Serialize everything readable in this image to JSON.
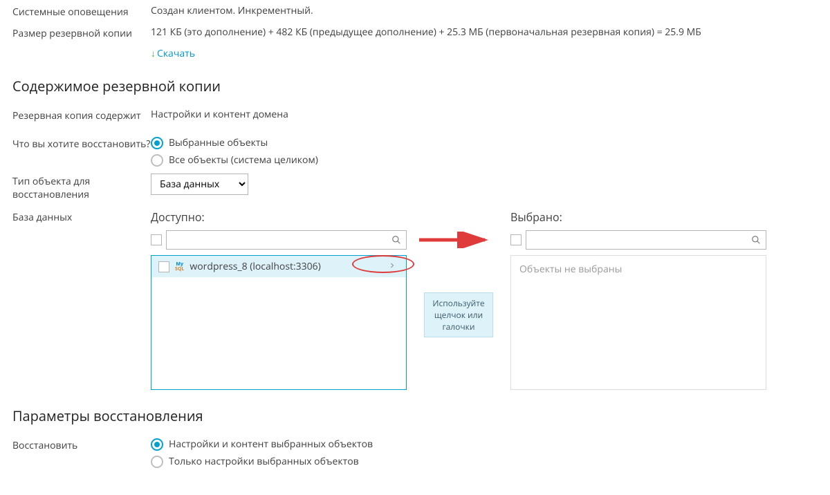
{
  "header": {
    "sys_notifications_label": "Системные оповещения",
    "sys_notifications_value": "Создан клиентом. Инкрементный.",
    "backup_size_label": "Размер резервной копии",
    "backup_size_value": "121 КБ (это дополнение) + 482 КБ (предыдущее дополнение) + 25.3 МБ (первоначальная резервная копия) = 25.9 МБ",
    "download_label": "Скачать"
  },
  "sections": {
    "content_title": "Содержимое резервной копии",
    "restore_params_title": "Параметры восстановления"
  },
  "content": {
    "backup_contains_label": "Резервная копия содержит",
    "backup_contains_value": "Настройки и контент домена",
    "what_restore_label": "Что вы хотите восстановить?",
    "restore_options": {
      "selected_objects": "Выбранные объекты",
      "all_objects": "Все объекты (система целиком)"
    },
    "object_type_label": "Тип объекта для восстановления",
    "object_type_value": "База данных",
    "db_row_label": "База данных"
  },
  "transfer": {
    "available_title": "Доступно:",
    "selected_title": "Выбрано:",
    "item_name": "wordpress_8 (localhost:3306)",
    "hint": "Используйте щелчок или галочки",
    "empty_selected": "Объекты не выбраны"
  },
  "restore_params": {
    "restore_label": "Восстановить",
    "options": {
      "settings_and_content": "Настройки и контент выбранных объектов",
      "settings_only": "Только настройки выбранных объектов"
    }
  }
}
